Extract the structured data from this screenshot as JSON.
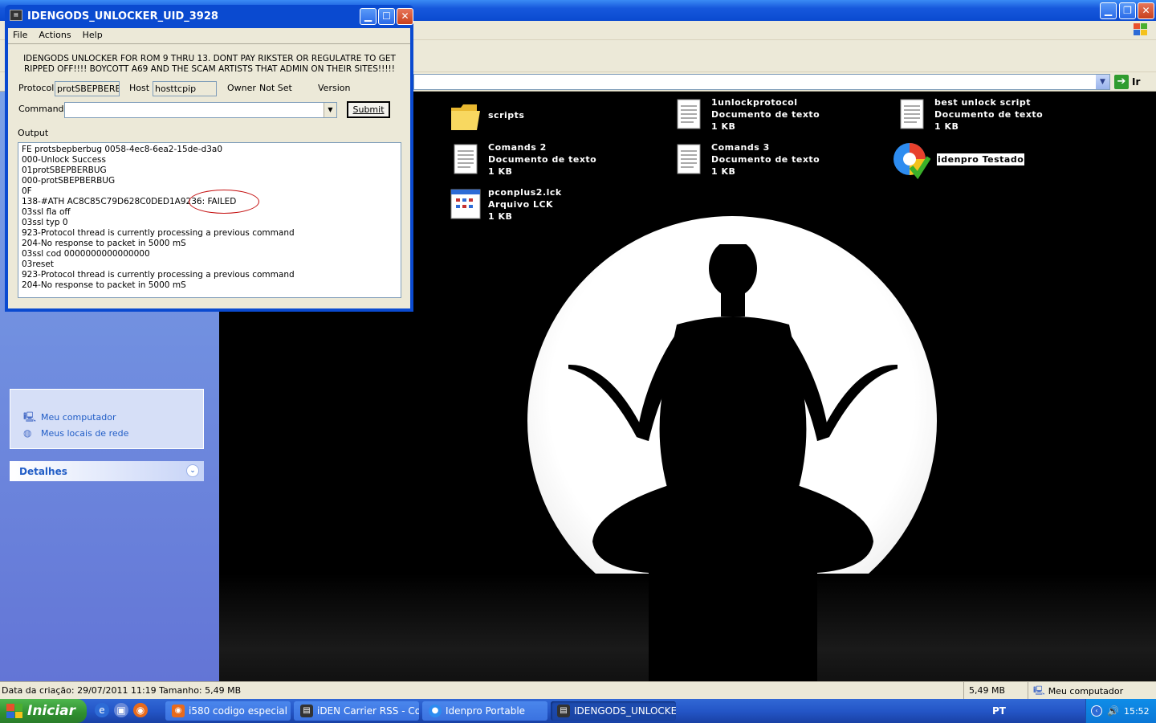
{
  "explorer": {
    "go_label": "Ir",
    "task_links": [
      {
        "label": "Meu computador"
      },
      {
        "label": "Meus locais de rede"
      }
    ],
    "details_title": "Detalhes",
    "files": [
      {
        "name": "scripts",
        "type": "",
        "size": "",
        "icon": "folder-icon"
      },
      {
        "name": "1unlockprotocol",
        "type": "Documento de texto",
        "size": "1 KB",
        "icon": "text-document-icon"
      },
      {
        "name": "best unlock script",
        "type": "Documento de texto",
        "size": "1 KB",
        "icon": "text-document-icon"
      },
      {
        "name": "Comands 2",
        "type": "Documento de texto",
        "size": "1 KB",
        "icon": "text-document-icon"
      },
      {
        "name": "Comands 3",
        "type": "Documento de texto",
        "size": "1 KB",
        "icon": "text-document-icon"
      },
      {
        "name": "idenpro Testado",
        "type": "",
        "size": "",
        "icon": "idenpro-app-icon"
      },
      {
        "name": "pconplus2.lck",
        "type": "Arquivo LCK",
        "size": "1 KB",
        "icon": "lck-file-icon"
      }
    ],
    "status": {
      "left": "Data da criação: 29/07/2011 11:19 Tamanho: 5,49 MB",
      "size": "5,49 MB",
      "location": "Meu computador"
    }
  },
  "dialog": {
    "title": "IDENGODS_UNLOCKER_UID_3928",
    "menu": [
      "File",
      "Actions",
      "Help"
    ],
    "banner": "IDENGODS UNLOCKER FOR ROM 9 THRU 13.  DONT PAY RIKSTER OR REGULATRE TO GET RIPPED OFF!!!!  BOYCOTT A69 AND THE SCAM ARTISTS THAT ADMIN ON THEIR SITES!!!!!",
    "protocol_label": "Protocol",
    "protocol_value": "protSBEPBERB",
    "host_label": "Host",
    "host_value": "hosttcpip",
    "owner_label": "Owner",
    "owner_value": "Not Set",
    "version_label": "Version",
    "command_label": "Command",
    "submit_label": "Submit",
    "output_label": "Output",
    "output_lines": [
      "FE protsbepberbug 0058-4ec8-6ea2-15de-d3a0",
      "000-Unlock Success",
      "01protSBEPBERBUG",
      "000-protSBEPBERBUG",
      "0F",
      "138-#ATH AC8C85C79D628C0DED1A9236: FAILED",
      "03ssl fla off",
      "03ssl typ 0",
      "923-Protocol thread is currently processing a previous command",
      "204-No response to packet in 5000 mS",
      "03ssl cod 0000000000000000",
      "03reset",
      "923-Protocol thread is currently processing a previous command",
      "204-No response to packet in 5000 mS"
    ]
  },
  "taskbar": {
    "start_label": "Iniciar",
    "buttons": [
      {
        "label": "i580 codigo especial -..."
      },
      {
        "label": "iDEN Carrier RSS - Co..."
      },
      {
        "label": "Idenpro Portable"
      },
      {
        "label": "IDENGODS_UNLOCKE..."
      }
    ],
    "language": "PT",
    "clock": "15:52"
  }
}
